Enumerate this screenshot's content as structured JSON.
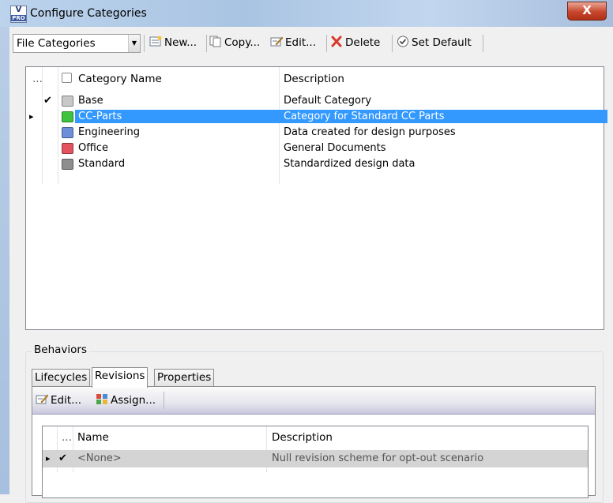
{
  "window": {
    "title": "Configure Categories",
    "close_label": "X",
    "app_icon_top": "V",
    "app_icon_bottom": "PRO"
  },
  "toolbar": {
    "category_type": "File Categories",
    "new_label": "New...",
    "copy_label": "Copy...",
    "edit_label": "Edit...",
    "delete_label": "Delete",
    "set_default_label": "Set Default"
  },
  "categories_grid": {
    "columns": {
      "marker": "...",
      "name": "Category Name",
      "description": "Description"
    },
    "rows": [
      {
        "name": "Base",
        "description": "Default Category",
        "color": "#c8c8c8",
        "is_default": true,
        "selected": false
      },
      {
        "name": "CC-Parts",
        "description": "Category for Standard CC Parts",
        "color": "#3fc33f",
        "is_default": false,
        "selected": true
      },
      {
        "name": "Engineering",
        "description": "Data created for design purposes",
        "color": "#6d8ed9",
        "is_default": false,
        "selected": false
      },
      {
        "name": "Office",
        "description": "General Documents",
        "color": "#e2525f",
        "is_default": false,
        "selected": false
      },
      {
        "name": "Standard",
        "description": "Standardized design data",
        "color": "#8e8e8e",
        "is_default": false,
        "selected": false
      }
    ]
  },
  "behaviors": {
    "label": "Behaviors",
    "tabs": [
      "Lifecycles",
      "Revisions",
      "Properties"
    ],
    "active_tab": "Revisions",
    "edit_label": "Edit...",
    "assign_label": "Assign...",
    "grid": {
      "columns": {
        "marker": "...",
        "name": "Name",
        "description": "Description"
      },
      "rows": [
        {
          "name": "<None>",
          "description": "Null revision scheme for opt-out scenario"
        }
      ]
    }
  },
  "glyphs": {
    "check": "✔",
    "row_pointer": "▸",
    "dropdown": "▼"
  },
  "colors": {
    "selection": "#3399ff",
    "close_button": "#c7462e",
    "title_bar": "#a9c4e3"
  }
}
